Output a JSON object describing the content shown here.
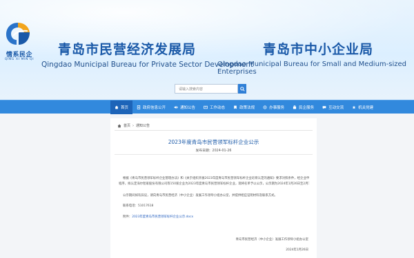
{
  "header": {
    "logo_text": "情系民企",
    "logo_sub": "QING XI MIN QI",
    "bureau1_cn": "青岛市民营经济发展局",
    "bureau1_en": "Qingdao Municipal Bureau for Private Sector Development",
    "bureau2_cn": "青岛市中小企业局",
    "bureau2_en": "Qingdao Municipal Bureau for Small and Medium-sized Enterprises",
    "search_placeholder": "请输入搜索内容"
  },
  "nav": {
    "items": [
      {
        "label": "首页",
        "icon": "home-icon"
      },
      {
        "label": "政府信息公开",
        "icon": "document-icon"
      },
      {
        "label": "通知公告",
        "icon": "notice-icon"
      },
      {
        "label": "工作动态",
        "icon": "news-icon"
      },
      {
        "label": "政策法规",
        "icon": "policy-icon"
      },
      {
        "label": "办事服务",
        "icon": "service-icon"
      },
      {
        "label": "民企服务",
        "icon": "enterprise-icon"
      },
      {
        "label": "互动交流",
        "icon": "chat-icon"
      },
      {
        "label": "机关党建",
        "icon": "party-icon"
      }
    ],
    "active_index": 0
  },
  "breadcrumb": {
    "home": "首页",
    "current": "通知公告"
  },
  "article": {
    "title": "2023年度青岛市民营领军标杆企业公示",
    "date_label": "发布日期：",
    "date": "2024-01-26",
    "para1_line1": "根据《青岛市民营领军标杆企业管理办法》和《关于组织开展2023年度青岛市民营领军标杆企业培育认定的通知》要求对照条件，经企业申报、区（市）推荐、专家评审等",
    "para1_line2": "程序，拟认定海尔智家股份有限公司等150家企业为2023年度青岛市民营领军标杆企业，现将名单予以公示，公示期为2024年1月26日至2月1日。",
    "para2": "公示期间如有异议，请向青岛市民营经济（中小企业）发展工作领导小组办公室，并提供相应证明材料及联系方式。",
    "contact_label": "联系电话：",
    "contact": "51017618",
    "attachment_label": "附件：",
    "attachment": "2023年度青岛市民营领军标杆企业公示.docx",
    "sign_org": "青岛市民营经济（中小企业）发展工作领导小组办公室",
    "sign_date": "2024年1月26日"
  }
}
